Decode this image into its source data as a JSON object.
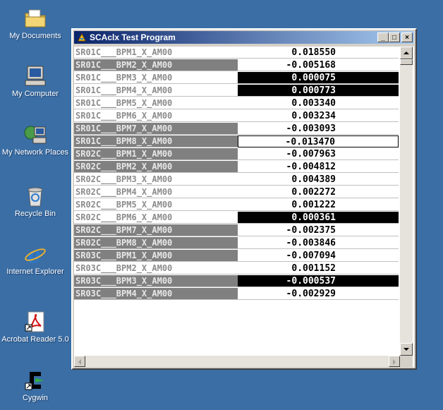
{
  "desktop": {
    "icons": [
      {
        "name": "folder-icon",
        "label": "My Documents"
      },
      {
        "name": "computer-icon",
        "label": "My Computer"
      },
      {
        "name": "network-icon",
        "label": "My Network Places"
      },
      {
        "name": "recycle-bin-icon",
        "label": "Recycle Bin"
      },
      {
        "name": "ie-icon",
        "label": "Internet Explorer"
      },
      {
        "name": "acrobat-icon",
        "label": "Acrobat Reader 5.0"
      },
      {
        "name": "cygwin-icon",
        "label": "Cygwin"
      }
    ]
  },
  "window": {
    "title": "SCAclx Test Program",
    "minimize_label": "_",
    "maximize_label": "□",
    "close_label": "×"
  },
  "rows": [
    {
      "name": "SR01C___BPM1_X_AM00",
      "value": "0.018550",
      "name_style": "light",
      "value_style": "normal"
    },
    {
      "name": "SR01C___BPM2_X_AM00",
      "value": "-0.005168",
      "name_style": "dark",
      "value_style": "normal"
    },
    {
      "name": "SR01C___BPM3_X_AM00",
      "value": "0.000075",
      "name_style": "light",
      "value_style": "black"
    },
    {
      "name": "SR01C___BPM4_X_AM00",
      "value": "0.000773",
      "name_style": "light",
      "value_style": "black"
    },
    {
      "name": "SR01C___BPM5_X_AM00",
      "value": "0.003340",
      "name_style": "light",
      "value_style": "normal"
    },
    {
      "name": "SR01C___BPM6_X_AM00",
      "value": "0.003234",
      "name_style": "light",
      "value_style": "normal"
    },
    {
      "name": "SR01C___BPM7_X_AM00",
      "value": "-0.003093",
      "name_style": "dark",
      "value_style": "normal"
    },
    {
      "name": "SR01C___BPM8_X_AM00",
      "value": "-0.013470",
      "name_style": "dark",
      "value_style": "focused"
    },
    {
      "name": "SR02C___BPM1_X_AM00",
      "value": "-0.007963",
      "name_style": "dark",
      "value_style": "normal"
    },
    {
      "name": "SR02C___BPM2_X_AM00",
      "value": "-0.004812",
      "name_style": "dark",
      "value_style": "normal"
    },
    {
      "name": "SR02C___BPM3_X_AM00",
      "value": "0.004389",
      "name_style": "light",
      "value_style": "normal"
    },
    {
      "name": "SR02C___BPM4_X_AM00",
      "value": "0.002272",
      "name_style": "light",
      "value_style": "normal"
    },
    {
      "name": "SR02C___BPM5_X_AM00",
      "value": "0.001222",
      "name_style": "light",
      "value_style": "normal"
    },
    {
      "name": "SR02C___BPM6_X_AM00",
      "value": "0.000361",
      "name_style": "light",
      "value_style": "black"
    },
    {
      "name": "SR02C___BPM7_X_AM00",
      "value": "-0.002375",
      "name_style": "dark",
      "value_style": "normal"
    },
    {
      "name": "SR02C___BPM8_X_AM00",
      "value": "-0.003846",
      "name_style": "dark",
      "value_style": "normal"
    },
    {
      "name": "SR03C___BPM1_X_AM00",
      "value": "-0.007094",
      "name_style": "dark",
      "value_style": "normal"
    },
    {
      "name": "SR03C___BPM2_X_AM00",
      "value": "0.001152",
      "name_style": "light",
      "value_style": "normal"
    },
    {
      "name": "SR03C___BPM3_X_AM00",
      "value": "-0.000537",
      "name_style": "dark",
      "value_style": "black"
    },
    {
      "name": "SR03C___BPM4_X_AM00",
      "value": "-0.002929",
      "name_style": "dark",
      "value_style": "normal"
    }
  ],
  "colors": {
    "desktop": "#3a6ea5",
    "title_start": "#0a246a",
    "title_end": "#a6caf0",
    "dark_cell": "#808080",
    "highlight_cell": "#000000"
  }
}
